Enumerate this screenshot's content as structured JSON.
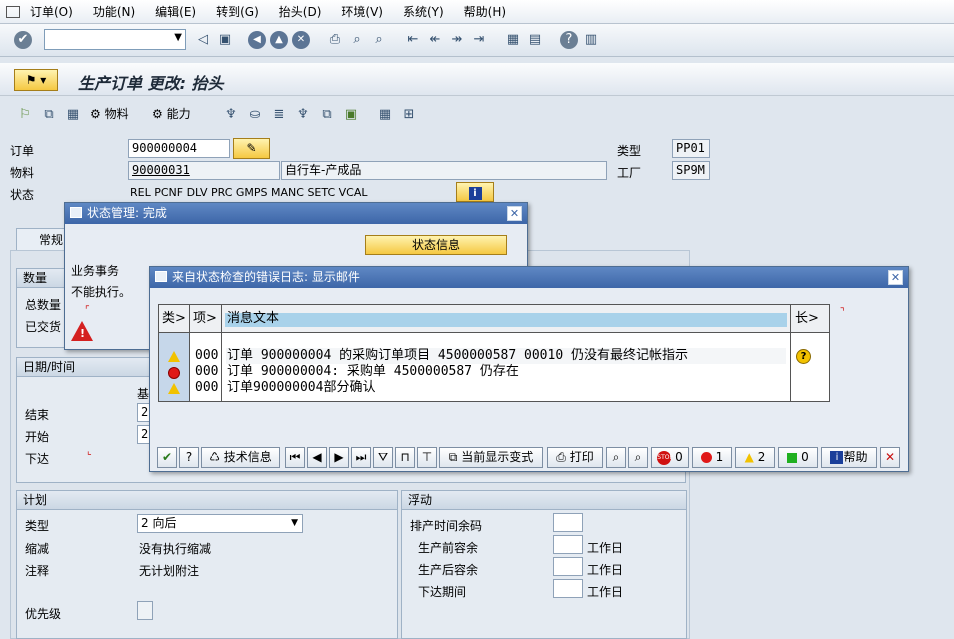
{
  "menu": [
    "订单(O)",
    "功能(N)",
    "编辑(E)",
    "转到(G)",
    "抬头(D)",
    "环境(V)",
    "系统(Y)",
    "帮助(H)"
  ],
  "title": "生产订单 更改: 抬头",
  "apptb": {
    "material": "物料",
    "capacity": "能力"
  },
  "header": {
    "order_label": "订单",
    "order_value": "900000004",
    "material_label": "物料",
    "material_value": "90000031",
    "material_desc": "自行车-产成品",
    "status_label": "状态",
    "status_value": "REL  PCNF DLV  PRC  GMPS MANC SETC VCAL",
    "type_label": "类型",
    "type_value": "PP01",
    "plant_label": "工厂",
    "plant_value": "SP9M"
  },
  "tab_general": "常规",
  "qty": {
    "title": "数量",
    "total": "总数量",
    "delivered": "已交货"
  },
  "dates": {
    "title": "日期/时间",
    "base": "基",
    "end": "结束",
    "start": "开始",
    "release": "下达",
    "end_val": "2",
    "start_val": "2"
  },
  "plan": {
    "title": "计划",
    "type_label": "类型",
    "type_value": "2 向后",
    "reduce_label": "缩减",
    "reduce_value": "没有执行缩减",
    "note_label": "注释",
    "note_value": "无计划附注",
    "priority_label": "优先级"
  },
  "float": {
    "title": "浮动",
    "sched_margin": "排产时间余码",
    "before": "生产前容余",
    "after": "生产后容余",
    "release_period": "下达期间",
    "workday": "工作日"
  },
  "status_dialog": {
    "title": "状态管理: 完成",
    "status_info": "状态信息",
    "biz_trans": "业务事务",
    "not_exec": "不能执行。"
  },
  "log_dialog": {
    "title": "来自状态检查的错误日志: 显示邮件",
    "col_class": "类>",
    "col_item": "项>",
    "col_text": "消息文本",
    "col_long": "长>",
    "rows": [
      {
        "type": "warning",
        "item": "000",
        "text": "订单 900000004 的采购订单项目 4500000587 00010 仍没有最终记帐指示"
      },
      {
        "type": "error",
        "item": "000",
        "text": "订单 900000004:  采购单 4500000587 仍存在"
      },
      {
        "type": "warning",
        "item": "000",
        "text": "订单900000004部分确认"
      }
    ],
    "btn_tech": "技术信息",
    "btn_layout": "当前显示变式",
    "btn_print": "打印",
    "cnt_stop": "0",
    "cnt_err": "1",
    "cnt_warn": "2",
    "cnt_ok": "0",
    "btn_help": "帮助"
  }
}
